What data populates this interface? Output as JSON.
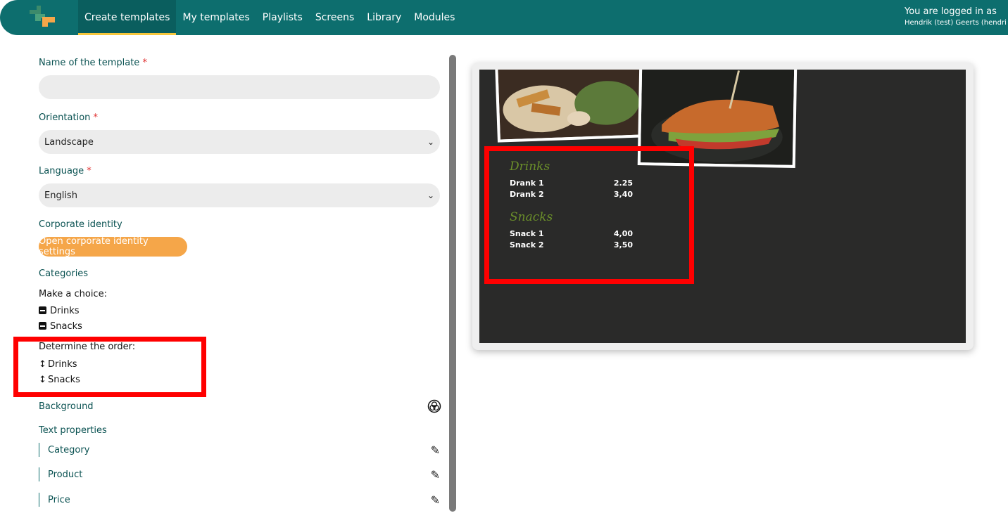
{
  "nav": {
    "items": [
      {
        "label": "Create templates",
        "active": true
      },
      {
        "label": "My templates"
      },
      {
        "label": "Playlists"
      },
      {
        "label": "Screens"
      },
      {
        "label": "Library"
      },
      {
        "label": "Modules"
      }
    ],
    "user_line1": "You are logged in as",
    "user_line2": "Hendrik (test) Geerts (hendri"
  },
  "form": {
    "name_label": "Name of the template",
    "name_value": "",
    "orientation_label": "Orientation",
    "orientation_value": "Landscape",
    "language_label": "Language",
    "language_value": "English",
    "corporate_label": "Corporate identity",
    "corporate_button": "Open corporate identity settings",
    "categories_label": "Categories",
    "make_choice": "Make a choice:",
    "choices": [
      "Drinks",
      "Snacks"
    ],
    "determine_order": "Determine the order:",
    "order": [
      "Drinks",
      "Snacks"
    ],
    "background_label": "Background",
    "text_props_label": "Text properties",
    "text_props": [
      "Category",
      "Product",
      "Price"
    ],
    "required_mark": "*"
  },
  "preview": {
    "categories": [
      {
        "name": "Drinks",
        "items": [
          {
            "name": "Drank 1",
            "price": "2.25"
          },
          {
            "name": "Drank 2",
            "price": "3,40"
          }
        ]
      },
      {
        "name": "Snacks",
        "items": [
          {
            "name": "Snack 1",
            "price": "4,00"
          },
          {
            "name": "Snack 2",
            "price": "3,50"
          }
        ]
      }
    ]
  },
  "colors": {
    "nav_bg": "#0d6e6e",
    "accent": "#f5a649",
    "highlight": "#ff0000",
    "screen_bg": "#2a2a29",
    "category_green": "#6b8f2a"
  },
  "icons": [
    "logo-icon",
    "checkbox-icon",
    "reorder-arrow-icon",
    "color-circles-icon",
    "pencil-icon",
    "chevron-down-icon"
  ]
}
